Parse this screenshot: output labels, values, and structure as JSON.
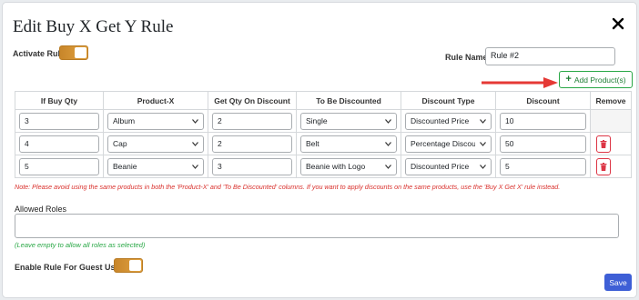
{
  "modal": {
    "title": "Edit Buy X Get Y Rule"
  },
  "activate_rule": {
    "label": "Activate Rule",
    "on": true
  },
  "rule_name": {
    "label": "Rule Name",
    "value": "Rule #2"
  },
  "add_button": {
    "label": "Add Product(s)"
  },
  "table": {
    "headers": [
      "If Buy Qty",
      "Product-X",
      "Get Qty On Discount",
      "To Be Discounted",
      "Discount Type",
      "Discount",
      "Remove"
    ],
    "rows": [
      {
        "buy_qty": "3",
        "product_x": "Album",
        "get_qty": "2",
        "discounted": "Single",
        "discount_type": "Discounted Price",
        "discount": "10"
      },
      {
        "buy_qty": "4",
        "product_x": "Cap",
        "get_qty": "2",
        "discounted": "Belt",
        "discount_type": "Percentage Discour",
        "discount": "50"
      },
      {
        "buy_qty": "5",
        "product_x": "Beanie",
        "get_qty": "3",
        "discounted": "Beanie with Logo",
        "discount_type": "Discounted Price",
        "discount": "5"
      }
    ]
  },
  "note": "Note: Please avoid using the same products in both the 'Product-X' and 'To Be Discounted' columns. If you want to apply discounts on the same products, use the 'Buy X Get X' rule instead.",
  "allowed_roles": {
    "label": "Allowed Roles",
    "value": "",
    "hint": "(Leave empty to allow all roles as selected)"
  },
  "guest_users": {
    "label": "Enable Rule For Guest Users?",
    "on": true
  },
  "save_button": {
    "label": "Save"
  },
  "colors": {
    "toggle": "#d5922f",
    "add_border": "#28a745",
    "arrow": "#e53935",
    "save": "#3e5fd6",
    "note": "#d9302c"
  },
  "icons": {
    "close": "close-icon",
    "add": "plus-icon",
    "remove": "trash-icon",
    "select": "chevron-down-icon"
  }
}
